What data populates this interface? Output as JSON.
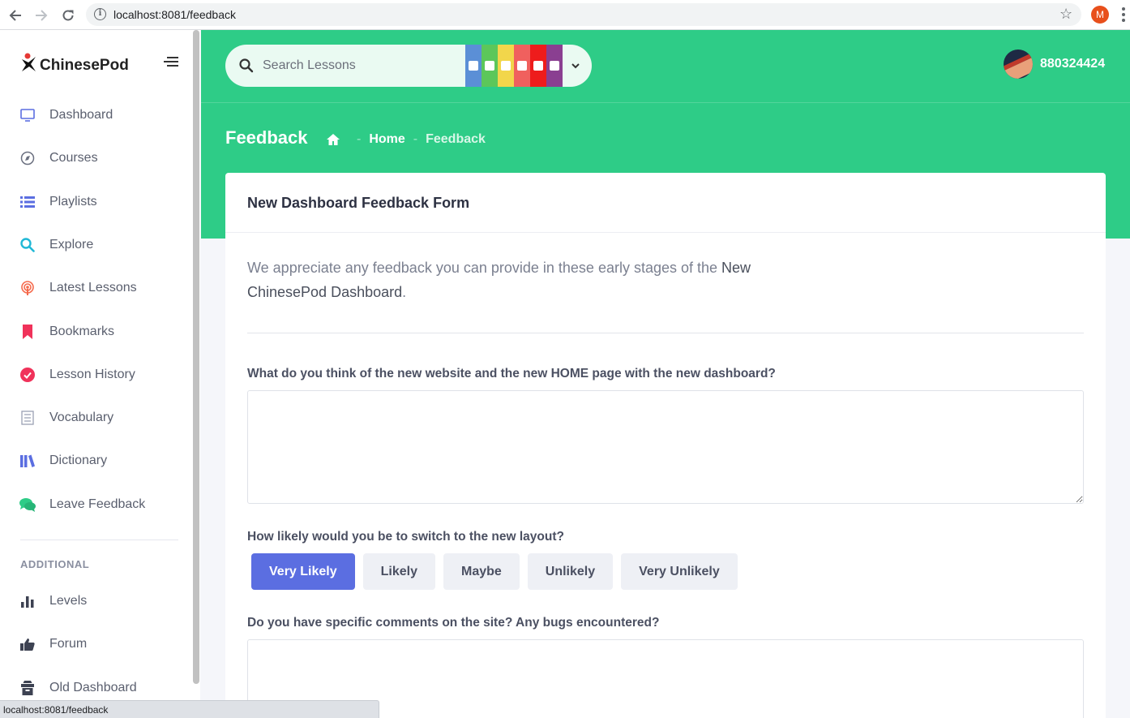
{
  "browser": {
    "url": "localhost:8081/feedback",
    "profile_initial": "M"
  },
  "sidebar": {
    "logo_text": "ChinesePod",
    "items": [
      {
        "label": "Dashboard",
        "icon": "monitor-icon",
        "color": "#5b6ee1"
      },
      {
        "label": "Courses",
        "icon": "compass-icon",
        "color": "#6b7080"
      },
      {
        "label": "Playlists",
        "icon": "list-icon",
        "color": "#5b6ee1"
      },
      {
        "label": "Explore",
        "icon": "search-icon",
        "color": "#21b8d6"
      },
      {
        "label": "Latest Lessons",
        "icon": "podcast-icon",
        "color": "#f56a4c"
      },
      {
        "label": "Bookmarks",
        "icon": "bookmark-icon",
        "color": "#f0325a"
      },
      {
        "label": "Lesson History",
        "icon": "check-circle-icon",
        "color": "#f0325a"
      },
      {
        "label": "Vocabulary",
        "icon": "notebook-icon",
        "color": "#9aa0b3"
      },
      {
        "label": "Dictionary",
        "icon": "books-icon",
        "color": "#5b6ee1"
      },
      {
        "label": "Leave Feedback",
        "icon": "comments-icon",
        "color": "#2ecc87"
      }
    ],
    "additional_title": "ADDITIONAL",
    "additional_items": [
      {
        "label": "Levels",
        "icon": "bar-chart-icon",
        "color": "#3d4252"
      },
      {
        "label": "Forum",
        "icon": "thumbs-up-icon",
        "color": "#3d4252"
      },
      {
        "label": "Old Dashboard",
        "icon": "archive-icon",
        "color": "#3d4252"
      }
    ]
  },
  "header": {
    "search_placeholder": "Search Lessons",
    "level_colors": [
      "#5b8fd6",
      "#5cc75a",
      "#f2d64b",
      "#f0605e",
      "#ee1c1c",
      "#8a3f91"
    ],
    "username": "880324424"
  },
  "page": {
    "title": "Feedback",
    "breadcrumb_home": "Home",
    "breadcrumb_current": "Feedback",
    "breadcrumb_sep": "-"
  },
  "form": {
    "title": "New Dashboard Feedback Form",
    "intro_start": "We appreciate any feedback you can provide in these early stages of the ",
    "intro_highlight": "New ChinesePod Dashboard",
    "intro_end": ".",
    "q1": "What do you think of the new website and the new HOME page with the new dashboard?",
    "q2": "How likely would you be to switch to the new layout?",
    "options": [
      "Very Likely",
      "Likely",
      "Maybe",
      "Unlikely",
      "Very Unlikely"
    ],
    "selected_option": "Very Likely",
    "q3": "Do you have specific comments on the site? Any bugs encountered?"
  },
  "status_bar": {
    "text": "localhost:8081/feedback"
  },
  "colors": {
    "brand_green": "#2ecc87",
    "accent": "#5b6ee1"
  }
}
